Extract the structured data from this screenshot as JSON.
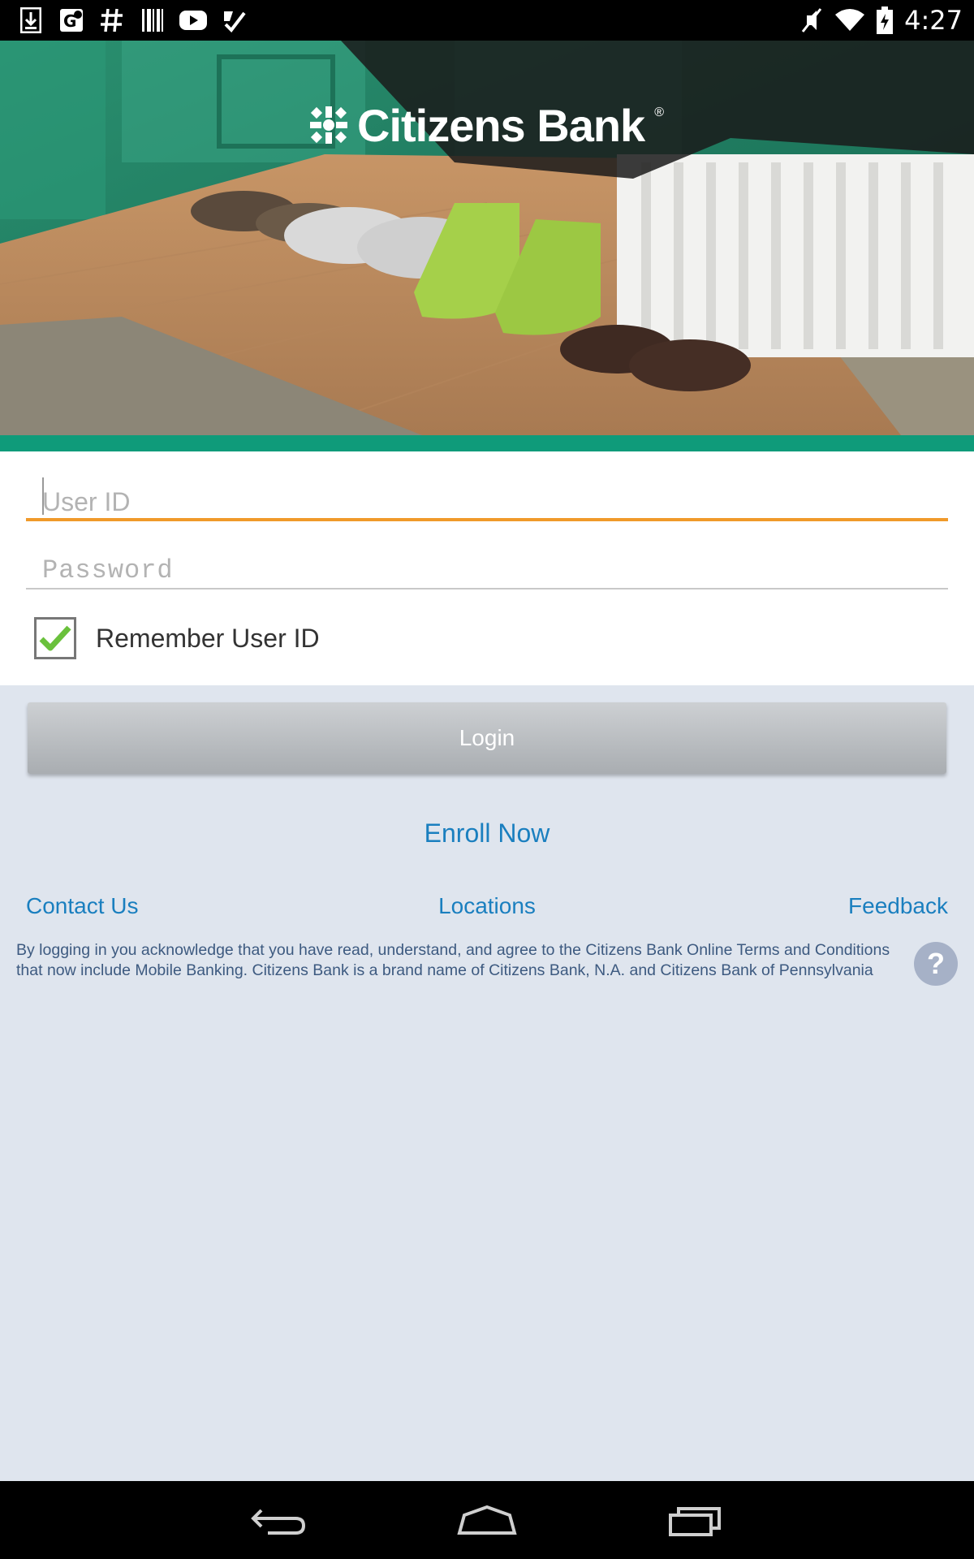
{
  "status_bar": {
    "time": "4:27",
    "left_icons": [
      "download-icon",
      "maps-icon",
      "hashtag-icon",
      "barcode-icon",
      "youtube-icon",
      "tasks-check-icon"
    ],
    "right_icons": [
      "mute-icon",
      "wifi-icon",
      "battery-charging-icon"
    ]
  },
  "brand": {
    "name": "Citizens Bank",
    "reg_mark": "®",
    "accent": "#0f9b7a"
  },
  "form": {
    "user_id_placeholder": "User ID",
    "password_placeholder": "Password",
    "remember_label": "Remember User ID",
    "remember_checked": true,
    "focus_color": "#f09a2a"
  },
  "actions": {
    "login_label": "Login",
    "enroll_label": "Enroll Now"
  },
  "links": {
    "contact": "Contact Us",
    "locations": "Locations",
    "feedback": "Feedback"
  },
  "disclaimer": "By logging in you acknowledge that you have read, understand, and agree to the Citizens Bank Online Terms and Conditions that now include Mobile Banking. Citizens Bank is a brand name of Citizens Bank, N.A. and Citizens Bank of Pennsylvania",
  "help_label": "?",
  "nav": [
    "back-icon",
    "home-icon",
    "recents-icon"
  ]
}
